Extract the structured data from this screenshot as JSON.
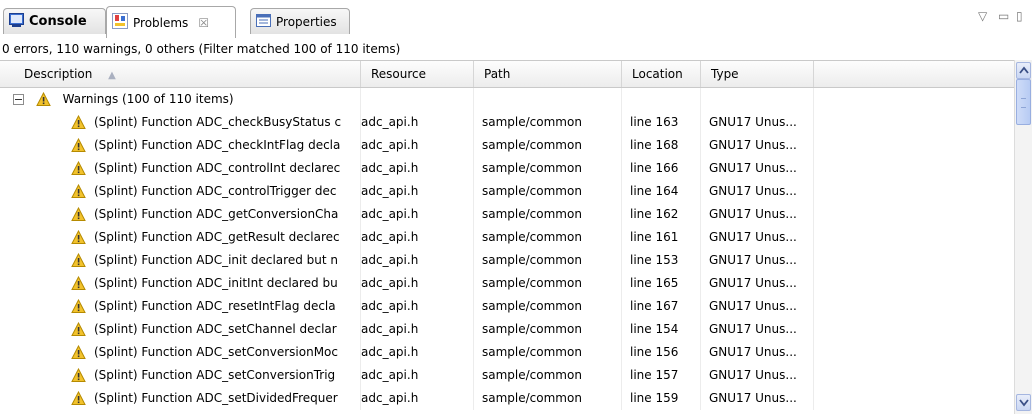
{
  "tabs": [
    {
      "label": "Console",
      "icon": "console-icon"
    },
    {
      "label": "Problems",
      "icon": "problems-icon",
      "close": "☒"
    },
    {
      "label": "Properties",
      "icon": "properties-icon"
    }
  ],
  "view_controls": {
    "menu": "▽",
    "minimize": "▭",
    "maximize": "▯"
  },
  "status": "0 errors, 110 warnings, 0 others (Filter matched 100 of 110 items)",
  "columns": [
    "Description",
    "Resource",
    "Path",
    "Location",
    "Type"
  ],
  "sort_indicator": "▲",
  "group": {
    "label": "Warnings (100 of 110 items)"
  },
  "rows": [
    {
      "desc": "(Splint) Function ADC_checkBusyStatus c",
      "resource": "adc_api.h",
      "path": "sample/common",
      "location": "line 163",
      "type": "GNU17 Unus..."
    },
    {
      "desc": "(Splint) Function ADC_checkIntFlag decla",
      "resource": "adc_api.h",
      "path": "sample/common",
      "location": "line 168",
      "type": "GNU17 Unus..."
    },
    {
      "desc": "(Splint) Function ADC_controlInt declarec",
      "resource": "adc_api.h",
      "path": "sample/common",
      "location": "line 166",
      "type": "GNU17 Unus..."
    },
    {
      "desc": "(Splint) Function ADC_controlTrigger dec",
      "resource": "adc_api.h",
      "path": "sample/common",
      "location": "line 164",
      "type": "GNU17 Unus..."
    },
    {
      "desc": "(Splint) Function ADC_getConversionCha",
      "resource": "adc_api.h",
      "path": "sample/common",
      "location": "line 162",
      "type": "GNU17 Unus..."
    },
    {
      "desc": "(Splint) Function ADC_getResult declarec",
      "resource": "adc_api.h",
      "path": "sample/common",
      "location": "line 161",
      "type": "GNU17 Unus..."
    },
    {
      "desc": "(Splint) Function ADC_init declared but n",
      "resource": "adc_api.h",
      "path": "sample/common",
      "location": "line 153",
      "type": "GNU17 Unus..."
    },
    {
      "desc": "(Splint) Function ADC_initInt declared bu",
      "resource": "adc_api.h",
      "path": "sample/common",
      "location": "line 165",
      "type": "GNU17 Unus..."
    },
    {
      "desc": "(Splint) Function ADC_resetIntFlag decla",
      "resource": "adc_api.h",
      "path": "sample/common",
      "location": "line 167",
      "type": "GNU17 Unus..."
    },
    {
      "desc": "(Splint) Function ADC_setChannel declar",
      "resource": "adc_api.h",
      "path": "sample/common",
      "location": "line 154",
      "type": "GNU17 Unus..."
    },
    {
      "desc": "(Splint) Function ADC_setConversionMoc",
      "resource": "adc_api.h",
      "path": "sample/common",
      "location": "line 156",
      "type": "GNU17 Unus..."
    },
    {
      "desc": "(Splint) Function ADC_setConversionTrig",
      "resource": "adc_api.h",
      "path": "sample/common",
      "location": "line 157",
      "type": "GNU17 Unus..."
    },
    {
      "desc": "(Splint) Function ADC_setDividedFrequer",
      "resource": "adc_api.h",
      "path": "sample/common",
      "location": "line 159",
      "type": "GNU17 Unus..."
    }
  ],
  "colors": {
    "warning": "#f2c22c",
    "selection_accent": "#3e68c5"
  }
}
